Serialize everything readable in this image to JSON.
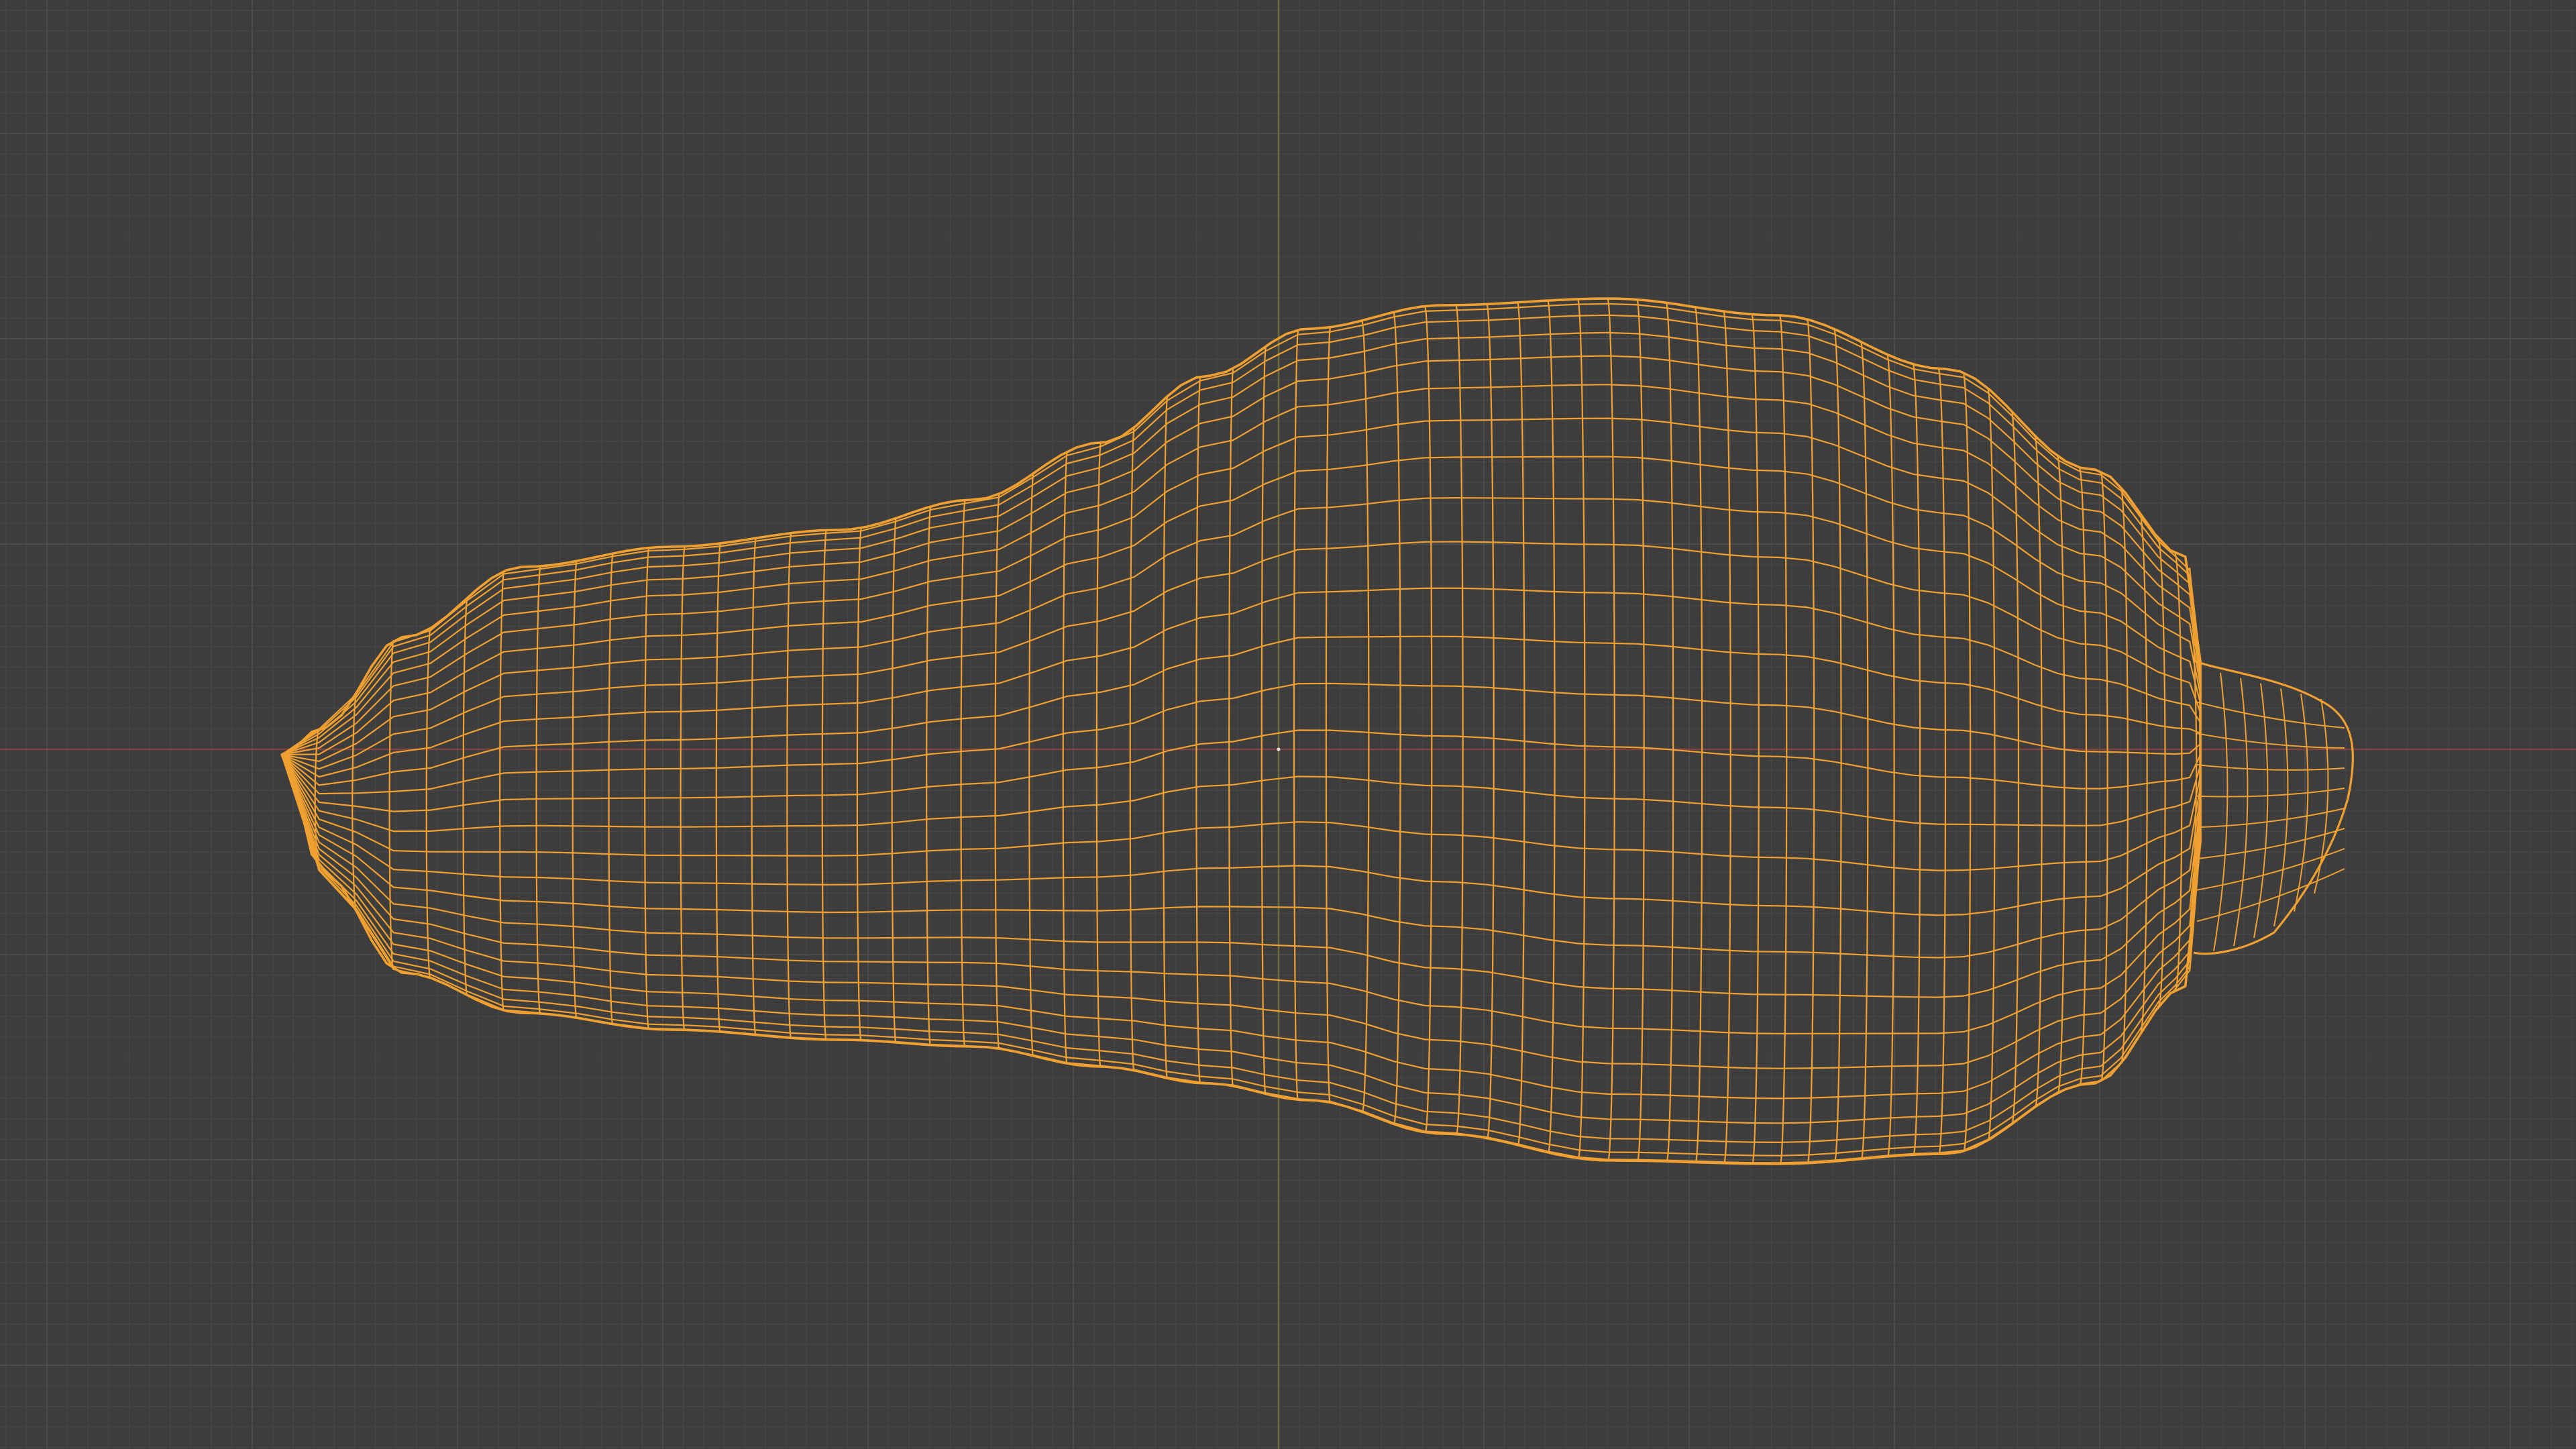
{
  "viewport": {
    "view": "3d-viewport",
    "shading_mode": "wireframe",
    "background_color": "#3d3d3d",
    "grid": {
      "visible": true,
      "minor_line_color": "#454545",
      "major_line_color": "#4b4b4b"
    },
    "axes": {
      "x_axis_color": "#7e4343",
      "y_axis_color": "#6b6b3a"
    },
    "selected_object": {
      "shape": "elongated gourd / squash mesh with short stem",
      "selected": true,
      "wire_color": "#f0a030",
      "origin_marker_color": "#e6e6e6"
    }
  }
}
